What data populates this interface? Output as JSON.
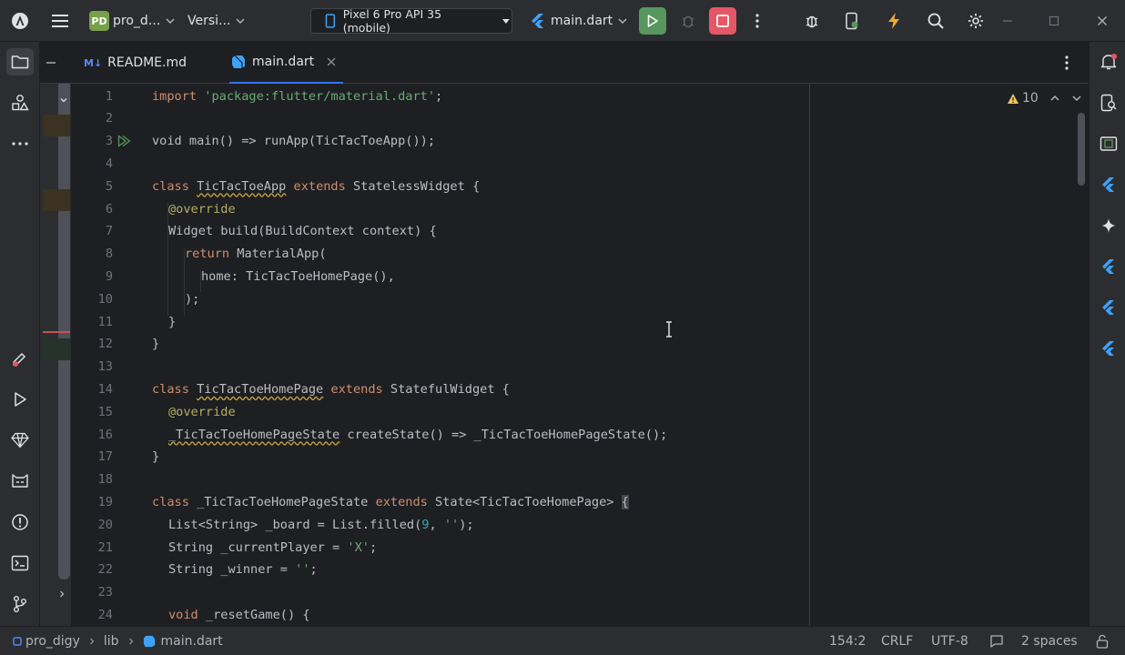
{
  "titlebar": {
    "project_badge": "PD",
    "project_name": "pro_d...",
    "vcs_label": "Versi...",
    "device_label": "Pixel 6 Pro API 35 (mobile)",
    "run_config": "main.dart"
  },
  "tabs": [
    {
      "badge": "M↓",
      "label": "README.md"
    },
    {
      "label": "main.dart"
    }
  ],
  "inspections": {
    "warning_count": "10"
  },
  "code_lines": [
    {
      "n": "1"
    },
    {
      "n": "2"
    },
    {
      "n": "3"
    },
    {
      "n": "4"
    },
    {
      "n": "5"
    },
    {
      "n": "6"
    },
    {
      "n": "7"
    },
    {
      "n": "8"
    },
    {
      "n": "9"
    },
    {
      "n": "10"
    },
    {
      "n": "11"
    },
    {
      "n": "12"
    },
    {
      "n": "13"
    },
    {
      "n": "14"
    },
    {
      "n": "15"
    },
    {
      "n": "16"
    },
    {
      "n": "17"
    },
    {
      "n": "18"
    },
    {
      "n": "19"
    },
    {
      "n": "20"
    },
    {
      "n": "21"
    },
    {
      "n": "22"
    },
    {
      "n": "23"
    },
    {
      "n": "24"
    }
  ],
  "code": {
    "l1": [
      "import ",
      "'package:flutter/material.dart'",
      ";"
    ],
    "l3": [
      "void main() => runApp(TicTacToeApp());"
    ],
    "l5": [
      "class ",
      "TicTacToeApp",
      " extends ",
      "StatelessWidget {"
    ],
    "l6": [
      "@override"
    ],
    "l7": [
      "Widget build(BuildContext context) {"
    ],
    "l8": [
      "return ",
      "MaterialApp("
    ],
    "l9": [
      "home: TicTacToeHomePage(),"
    ],
    "l10": [
      ");"
    ],
    "l11": [
      "}"
    ],
    "l12": [
      "}"
    ],
    "l14": [
      "class ",
      "TicTacToeHomePage",
      " extends ",
      "StatefulWidget {"
    ],
    "l15": [
      "@override"
    ],
    "l16": [
      "_TicTacToeHomePageState",
      " createState() => _TicTacToeHomePageState();"
    ],
    "l17": [
      "}"
    ],
    "l19": [
      "class ",
      "_TicTacToeHomePageState ",
      "extends ",
      "State<TicTacToeHomePage> ",
      "{"
    ],
    "l20": [
      "List<String> _board = List.filled(",
      "9",
      ", ",
      "''",
      ");"
    ],
    "l21": [
      "String _currentPlayer = ",
      "'X'",
      ";"
    ],
    "l22": [
      "String _winner = ",
      "''",
      ";"
    ],
    "l24": [
      "void ",
      "_resetGame() {"
    ]
  },
  "statusbar": {
    "breadcrumb_project": "pro_digy",
    "breadcrumb_folder": "lib",
    "breadcrumb_file": "main.dart",
    "caret": "154:2",
    "line_sep": "CRLF",
    "encoding": "UTF-8",
    "indent": "2 spaces"
  },
  "colors": {
    "accent": "#3574f0",
    "run_green": "#57965c",
    "stop_red": "#e55765",
    "flutter_blue": "#3ea2f7"
  }
}
